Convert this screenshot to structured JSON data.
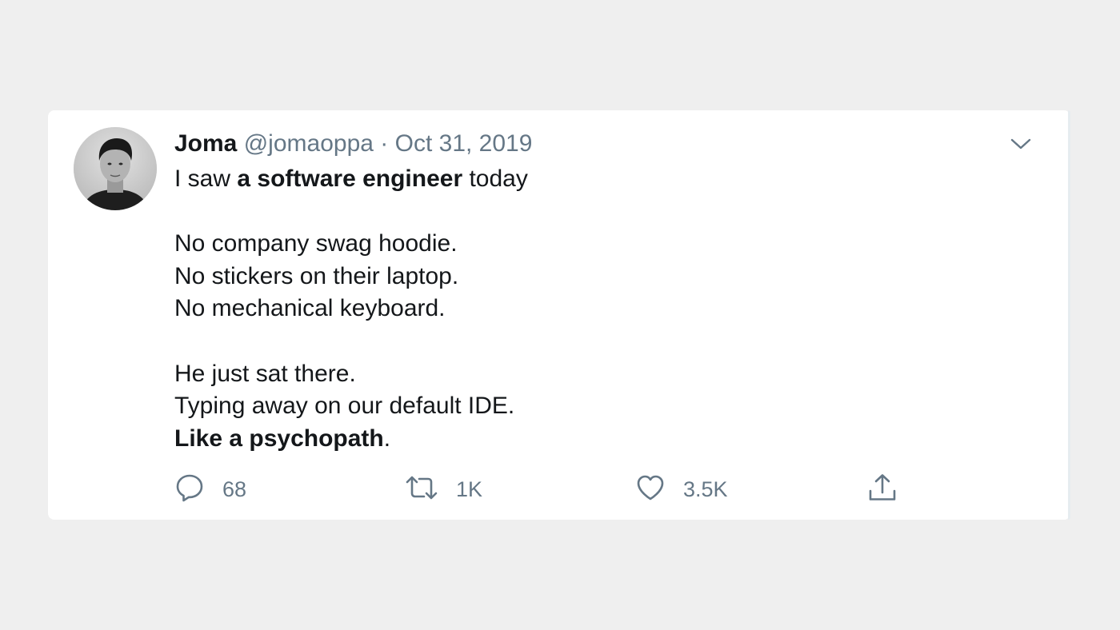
{
  "tweet": {
    "author_name": "Joma",
    "author_handle": "@jomaoppa",
    "separator": "·",
    "date": "Oct 31, 2019",
    "body": {
      "line1_pre": "I saw ",
      "line1_bold": "a software engineer",
      "line1_post": " today",
      "line2": "No company swag hoodie.",
      "line3": "No stickers on their laptop.",
      "line4": "No mechanical keyboard.",
      "line5": "He just sat there.",
      "line6": "Typing away on our default IDE.",
      "line7_bold": "Like a psychopath",
      "line7_post": "."
    },
    "actions": {
      "reply_count": "68",
      "retweet_count": "1K",
      "like_count": "3.5K"
    }
  },
  "icons": {
    "menu": "chevron-down-icon",
    "reply": "reply-icon",
    "retweet": "retweet-icon",
    "like": "heart-icon",
    "share": "share-icon"
  },
  "colors": {
    "background": "#efefef",
    "card": "#ffffff",
    "text": "#14171a",
    "secondary": "#657786"
  }
}
